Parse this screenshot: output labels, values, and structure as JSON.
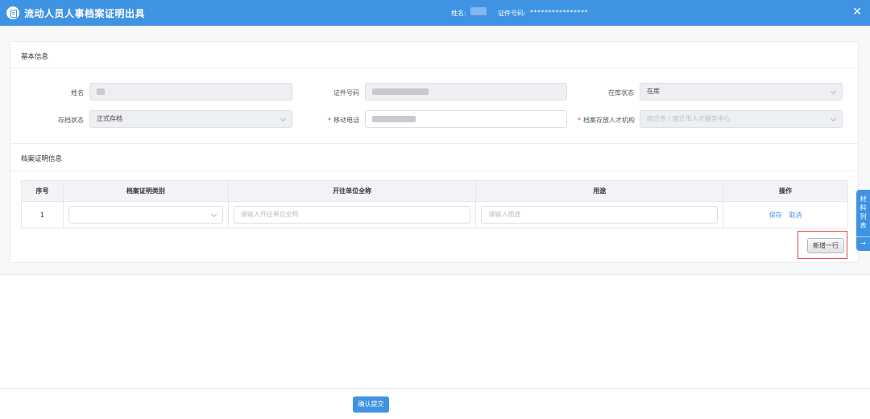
{
  "header": {
    "title": "流动人员人事档案证明出具",
    "name_label": "姓名:",
    "id_label": "证件号码:",
    "id_value": "****************",
    "close_icon": "close-icon"
  },
  "basic_info": {
    "section_title": "基本信息",
    "name_label": "姓名",
    "id_label": "证件号码",
    "status_label": "在库状态",
    "status_value": "在库",
    "archive_state_label": "存档状态",
    "archive_state_value": "正式存档",
    "mobile_label": "移动电话",
    "agency_label": "档案存放人才机构",
    "agency_value": "宿迁市 / 宿迁市人才服务中心"
  },
  "cert_info": {
    "section_title": "档案证明信息",
    "columns": [
      "序号",
      "档案证明类别",
      "开往单位全称",
      "用途",
      "操作"
    ],
    "rows": [
      {
        "index": "1",
        "unit_placeholder": "请输入开往单位全称",
        "purpose_placeholder": "请输入用途",
        "save_label": "保存",
        "cancel_label": "取消"
      }
    ],
    "add_row_label": "新增一行"
  },
  "side_tab": {
    "label_chars": [
      "材",
      "料",
      "列",
      "表"
    ],
    "arrow": "→"
  },
  "footer": {
    "submit_label": "确认提交"
  },
  "colors": {
    "primary": "#3f93e3",
    "required": "#e23c3c",
    "highlight_box": "#e34b4b"
  }
}
